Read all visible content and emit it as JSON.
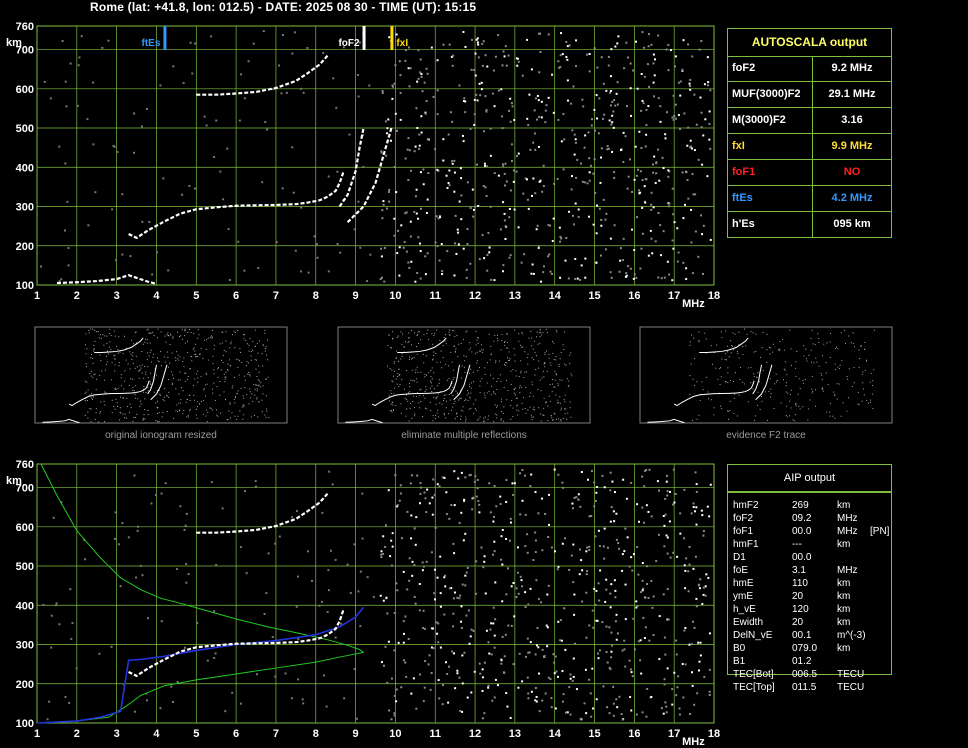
{
  "header": "Rome (lat: +41.8, lon: 012.5) - DATE: 2025 08 30 - TIME (UT): 15:15",
  "colors": {
    "grid": "#7fbf3f",
    "autoscala_title": "#ffff66",
    "fxi": "#ffdd00",
    "foF1": "#ff2020",
    "ftEs": "#3399ff",
    "profile": "#22cc22",
    "model_trace": "#2233dd"
  },
  "autoscala": {
    "title": "AUTOSCALA output",
    "rows": [
      {
        "key": "foF2",
        "value": "9.2 MHz",
        "color": "#ffffff"
      },
      {
        "key": "MUF(3000)F2",
        "value": "29.1 MHz",
        "color": "#ffffff"
      },
      {
        "key": "M(3000)F2",
        "value": "3.16",
        "color": "#ffffff"
      },
      {
        "key": "fxI",
        "value": "9.9 MHz",
        "color": "#ffdd33"
      },
      {
        "key": "foF1",
        "value": "NO",
        "color": "#ff2020"
      },
      {
        "key": "ftEs",
        "value": "4.2 MHz",
        "color": "#3399ff"
      },
      {
        "key": "h'Es",
        "value": "095    km",
        "color": "#ffffff"
      }
    ]
  },
  "aip": {
    "title": "AIP output",
    "rows": [
      {
        "name": "hmF2",
        "value": "269",
        "unit": "km",
        "extra": ""
      },
      {
        "name": "foF2",
        "value": "09.2",
        "unit": "MHz",
        "extra": ""
      },
      {
        "name": "foF1",
        "value": "00.0",
        "unit": "MHz",
        "extra": "[PN]"
      },
      {
        "name": "hmF1",
        "value": "---",
        "unit": "km",
        "extra": ""
      },
      {
        "name": "D1",
        "value": "00.0",
        "unit": "",
        "extra": ""
      },
      {
        "name": "foE",
        "value": "3.1",
        "unit": "MHz",
        "extra": ""
      },
      {
        "name": "hmE",
        "value": "110",
        "unit": "km",
        "extra": ""
      },
      {
        "name": "ymE",
        "value": "20",
        "unit": "km",
        "extra": ""
      },
      {
        "name": "h_vE",
        "value": "120",
        "unit": "km",
        "extra": ""
      },
      {
        "name": "Ewidth",
        "value": "20",
        "unit": "km",
        "extra": ""
      },
      {
        "name": "DelN_vE",
        "value": "00.1",
        "unit": "m^(-3)",
        "extra": ""
      },
      {
        "name": "B0",
        "value": "079.0",
        "unit": "km",
        "extra": ""
      },
      {
        "name": "B1",
        "value": "01.2",
        "unit": "",
        "extra": ""
      },
      {
        "name": "TEC[Bot]",
        "value": "006.5",
        "unit": "TECU",
        "extra": ""
      },
      {
        "name": "TEC[Top]",
        "value": "011.5",
        "unit": "TECU",
        "extra": ""
      }
    ]
  },
  "thumbnails": [
    {
      "caption": "original ionogram resized"
    },
    {
      "caption": "eliminate multiple reflections"
    },
    {
      "caption": "evidence F2 trace"
    }
  ],
  "chart_data": [
    {
      "type": "scatter",
      "xlabel": "MHz",
      "ylabel": "km",
      "xlim": [
        1,
        18
      ],
      "ylim": [
        100,
        760
      ],
      "x_ticks": [
        1,
        2,
        3,
        4,
        5,
        6,
        7,
        8,
        9,
        10,
        11,
        12,
        13,
        14,
        15,
        16,
        17,
        18
      ],
      "y_ticks": [
        100,
        200,
        300,
        400,
        500,
        600,
        700,
        760
      ],
      "markers": [
        {
          "label": "ftEs",
          "x": 4.2,
          "color": "#3399ff"
        },
        {
          "label": "foF2",
          "x": 9.2,
          "color": "#ffffff"
        },
        {
          "label": "fxI",
          "x": 9.9,
          "color": "#ffdd00"
        }
      ],
      "series": [
        {
          "x": [
            3.3,
            3.5,
            3.8,
            4.2,
            4.6,
            5.0,
            5.5,
            6.0,
            6.5,
            7.0,
            7.5,
            7.8,
            8.1,
            8.3,
            8.5,
            8.6,
            8.7
          ],
          "y": [
            230,
            220,
            240,
            262,
            282,
            293,
            298,
            302,
            303,
            304,
            306,
            310,
            316,
            325,
            340,
            360,
            390
          ]
        },
        {
          "x": [
            8.6,
            8.8,
            9.0,
            9.1,
            9.2
          ],
          "y": [
            300,
            330,
            390,
            450,
            500
          ]
        },
        {
          "x": [
            8.8,
            9.2,
            9.5,
            9.7,
            9.9
          ],
          "y": [
            260,
            300,
            360,
            430,
            500
          ]
        },
        {
          "x": [
            5.0,
            5.5,
            6.0,
            6.5,
            7.0,
            7.5,
            7.8,
            8.1,
            8.3
          ],
          "y": [
            585,
            585,
            588,
            592,
            602,
            620,
            640,
            662,
            685
          ]
        },
        {
          "x": [
            1.5,
            2.0,
            2.5,
            3.0,
            3.3,
            3.8,
            4.0
          ],
          "y": [
            105,
            107,
            110,
            115,
            125,
            108,
            103
          ]
        }
      ]
    },
    {
      "type": "line",
      "xlabel": "MHz",
      "ylabel": "km",
      "xlim": [
        1,
        18
      ],
      "ylim": [
        100,
        760
      ],
      "x_ticks": [
        1,
        2,
        3,
        4,
        5,
        6,
        7,
        8,
        9,
        10,
        11,
        12,
        13,
        14,
        15,
        16,
        17,
        18
      ],
      "y_ticks": [
        100,
        200,
        300,
        400,
        500,
        600,
        700,
        760
      ],
      "series": [
        {
          "x": [
            1.1,
            1.5,
            2.0,
            2.6,
            3.1,
            3.6,
            4.1,
            4.6,
            5.2,
            6.0,
            6.8,
            7.6,
            8.3,
            8.8,
            9.1,
            9.2
          ],
          "y": [
            760,
            680,
            590,
            520,
            470,
            440,
            418,
            405,
            388,
            365,
            345,
            328,
            312,
            298,
            287,
            280
          ]
        },
        {
          "x": [
            1.0,
            2.0,
            2.8,
            3.2,
            3.6,
            4.2,
            5.0,
            6.0,
            7.0,
            8.0,
            8.6,
            9.0,
            9.2
          ],
          "y": [
            100,
            105,
            115,
            140,
            170,
            195,
            210,
            225,
            240,
            255,
            268,
            276,
            280
          ]
        },
        {
          "x": [
            1.0,
            2.0,
            2.6,
            3.1,
            3.3,
            3.6,
            4.2,
            5.0,
            6.0,
            7.0,
            8.0,
            8.6,
            9.0,
            9.2
          ],
          "y": [
            100,
            105,
            115,
            130,
            260,
            262,
            270,
            285,
            300,
            310,
            325,
            345,
            370,
            395
          ]
        },
        {
          "x": [
            3.3,
            3.5,
            3.8,
            4.2,
            4.6,
            5.0,
            5.5,
            6.0,
            6.5,
            7.0,
            7.5,
            7.8,
            8.1,
            8.3,
            8.5,
            8.6,
            8.7
          ],
          "y": [
            230,
            220,
            240,
            262,
            282,
            293,
            298,
            302,
            303,
            304,
            306,
            310,
            316,
            325,
            340,
            360,
            390
          ]
        },
        {
          "x": [
            5.0,
            5.5,
            6.0,
            6.5,
            7.0,
            7.5,
            7.8,
            8.1,
            8.3
          ],
          "y": [
            585,
            585,
            588,
            592,
            602,
            620,
            640,
            662,
            685
          ]
        }
      ]
    }
  ]
}
